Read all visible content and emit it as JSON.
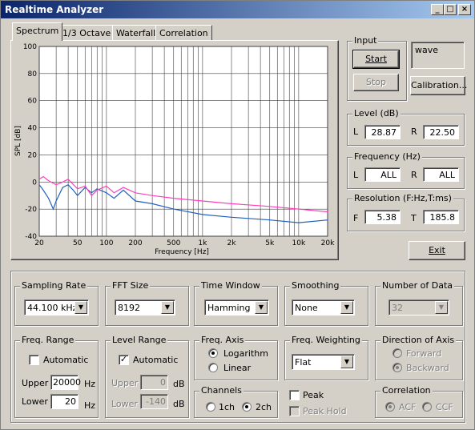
{
  "window": {
    "title": "Realtime Analyzer"
  },
  "tabs": [
    "Spectrum",
    "1/3 Octave",
    "Waterfall",
    "Correlation"
  ],
  "chart_data": {
    "type": "line",
    "ylabel": "SPL [dB]",
    "xlabel": "Frequency [Hz]",
    "x_scale": "log",
    "xlim": [
      20,
      20000
    ],
    "ylim": [
      -40,
      100
    ],
    "x_ticks": [
      "20",
      "50",
      "100",
      "200",
      "500",
      "1k",
      "2k",
      "5k",
      "10k",
      "20k"
    ],
    "y_ticks": [
      "100",
      "80",
      "60",
      "40",
      "20",
      "0",
      "-20",
      "-40"
    ],
    "grid": true,
    "series": [
      {
        "color": "#2060c0",
        "x": [
          20,
          22,
          25,
          28,
          30,
          35,
          40,
          45,
          50,
          60,
          70,
          80,
          100,
          120,
          150,
          200,
          300,
          500,
          1000,
          2000,
          5000,
          10000,
          20000
        ],
        "y": [
          -2,
          -6,
          -12,
          -20,
          -14,
          -4,
          -2,
          -6,
          -10,
          -4,
          -8,
          -5,
          -8,
          -12,
          -6,
          -14,
          -16,
          -20,
          -24,
          -26,
          -28,
          -30,
          -28
        ]
      },
      {
        "color": "#ff40c0",
        "x": [
          20,
          22,
          25,
          30,
          35,
          40,
          50,
          60,
          70,
          80,
          100,
          120,
          150,
          200,
          300,
          500,
          1000,
          2000,
          5000,
          10000,
          20000
        ],
        "y": [
          2,
          4,
          1,
          -2,
          0,
          2,
          -5,
          -3,
          -10,
          -6,
          -3,
          -8,
          -4,
          -8,
          -10,
          -12,
          -14,
          -16,
          -18,
          -20,
          -22
        ]
      }
    ],
    "colors": {
      "grid": "#404040",
      "plot_bg": "#ffffff"
    }
  },
  "input": {
    "label": "Input",
    "start": "Start",
    "stop": "Stop",
    "source": "wave",
    "calibration": "Calibration..."
  },
  "level": {
    "label": "Level (dB)",
    "l_label": "L",
    "l_value": "28.87",
    "r_label": "R",
    "r_value": "22.50"
  },
  "frequency": {
    "label": "Frequency (Hz)",
    "l_label": "L",
    "l_value": "ALL",
    "r_label": "R",
    "r_value": "ALL"
  },
  "resolution": {
    "label": "Resolution (F:Hz,T:ms)",
    "f_label": "F",
    "f_value": "5.38",
    "t_label": "T",
    "t_value": "185.8"
  },
  "exit": "Exit",
  "sampling_rate": {
    "label": "Sampling Rate",
    "value": "44.100 kHz"
  },
  "fft_size": {
    "label": "FFT Size",
    "value": "8192"
  },
  "time_window": {
    "label": "Time Window",
    "value": "Hamming"
  },
  "smoothing": {
    "label": "Smoothing",
    "value": "None"
  },
  "number_of_data": {
    "label": "Number of Data",
    "value": "32"
  },
  "freq_range": {
    "label": "Freq. Range",
    "automatic": "Automatic",
    "upper_label": "Upper",
    "upper_value": "20000",
    "upper_unit": "Hz",
    "lower_label": "Lower",
    "lower_value": "20",
    "lower_unit": "Hz"
  },
  "level_range": {
    "label": "Level Range",
    "automatic": "Automatic",
    "upper_label": "Upper",
    "upper_value": "0",
    "upper_unit": "dB",
    "lower_label": "Lower",
    "lower_value": "-140",
    "lower_unit": "dB"
  },
  "freq_axis": {
    "label": "Freq. Axis",
    "log": "Logarithm",
    "linear": "Linear"
  },
  "channels": {
    "label": "Channels",
    "one": "1ch",
    "two": "2ch"
  },
  "freq_weighting": {
    "label": "Freq. Weighting",
    "value": "Flat"
  },
  "peak": {
    "peak": "Peak",
    "peak_hold": "Peak Hold"
  },
  "direction": {
    "label": "Direction of Axis",
    "forward": "Forward",
    "backward": "Backward"
  },
  "correlation": {
    "label": "Correlation",
    "acf": "ACF",
    "ccf": "CCF"
  }
}
